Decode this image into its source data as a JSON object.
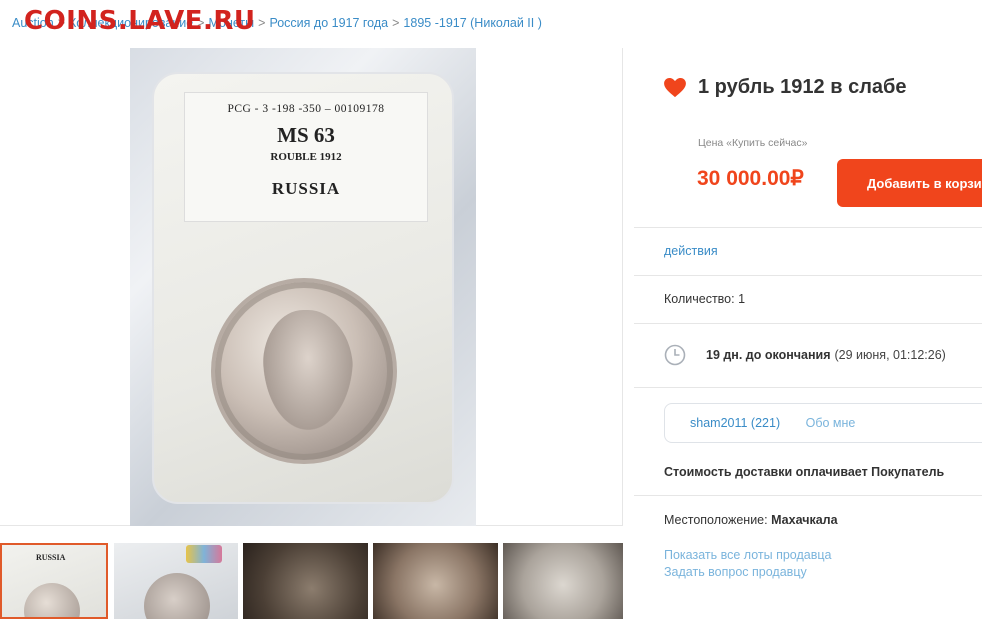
{
  "watermark": "COINS.LAVE.RU",
  "breadcrumb": {
    "items": [
      "Auction",
      "Коллекционирование",
      "Монеты",
      "Россия до 1917 года",
      "1895 -1917 (Николай II )"
    ],
    "separator": ">"
  },
  "photo": {
    "label_line1": "PCG - 3 -198 -350 – 00109178",
    "label_grade": "MS 63",
    "label_coin": "ROUBLE 1912",
    "label_country": "RUSSIA",
    "thumb1_label": "RUSSIA",
    "thumb_count": 5,
    "selected_thumb": 1
  },
  "lot": {
    "favorite_icon": "heart-icon",
    "title": "1 рубль 1912 в слабе",
    "price_label": "Цена «Купить сейчас»",
    "price": "30 000.00₽",
    "cart_button": "Добавить в корзину",
    "actions_link": "действия",
    "quantity": "Количество: 1",
    "timer_icon": "clock-icon",
    "time_left": "19 дн. до окончания",
    "end_time": "(29 июня, 01:12:26)",
    "seller": "sham2011 (221)",
    "about_link": "Обо мне",
    "shipping": "Стоимость доставки оплачивает Покупатель",
    "location_label": "Местоположение:",
    "location_value": "Махачкала",
    "link_all_lots": "Показать все лоты продавца",
    "link_ask": "Задать вопрос продавцу"
  },
  "colors": {
    "accent": "#f0451c",
    "link": "#3a8cc7",
    "watermark": "#d2231e"
  }
}
